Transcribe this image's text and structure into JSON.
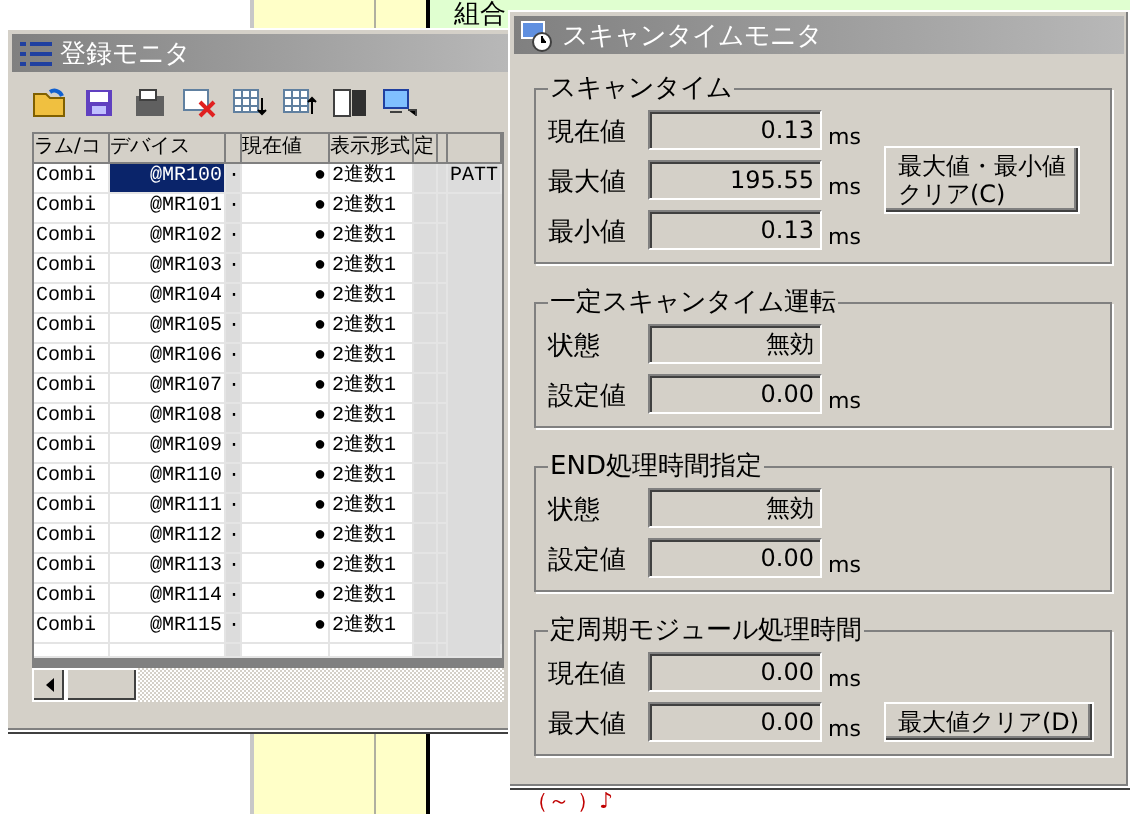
{
  "background": {
    "top_text": "組合",
    "bottom_text": "（～ ）♪"
  },
  "register_monitor": {
    "title": "登録モニタ",
    "columns": [
      "ラム/コ",
      "デバイス",
      "現在値",
      "表示形式",
      "定"
    ],
    "rows": [
      {
        "program": "Combi",
        "device": "@MR100",
        "flag": "·",
        "value": "●",
        "format": "2進数1",
        "comment": "PATT",
        "selected": true
      },
      {
        "program": "Combi",
        "device": "@MR101",
        "flag": "·",
        "value": "●",
        "format": "2進数1",
        "selected": false
      },
      {
        "program": "Combi",
        "device": "@MR102",
        "flag": "·",
        "value": "●",
        "format": "2進数1",
        "selected": false
      },
      {
        "program": "Combi",
        "device": "@MR103",
        "flag": "·",
        "value": "●",
        "format": "2進数1",
        "selected": false
      },
      {
        "program": "Combi",
        "device": "@MR104",
        "flag": "·",
        "value": "●",
        "format": "2進数1",
        "selected": false
      },
      {
        "program": "Combi",
        "device": "@MR105",
        "flag": "·",
        "value": "●",
        "format": "2進数1",
        "selected": false
      },
      {
        "program": "Combi",
        "device": "@MR106",
        "flag": "·",
        "value": "●",
        "format": "2進数1",
        "selected": false
      },
      {
        "program": "Combi",
        "device": "@MR107",
        "flag": "·",
        "value": "●",
        "format": "2進数1",
        "selected": false
      },
      {
        "program": "Combi",
        "device": "@MR108",
        "flag": "·",
        "value": "●",
        "format": "2進数1",
        "selected": false
      },
      {
        "program": "Combi",
        "device": "@MR109",
        "flag": "·",
        "value": "●",
        "format": "2進数1",
        "selected": false
      },
      {
        "program": "Combi",
        "device": "@MR110",
        "flag": "·",
        "value": "●",
        "format": "2進数1",
        "selected": false
      },
      {
        "program": "Combi",
        "device": "@MR111",
        "flag": "·",
        "value": "●",
        "format": "2進数1",
        "selected": false
      },
      {
        "program": "Combi",
        "device": "@MR112",
        "flag": "·",
        "value": "●",
        "format": "2進数1",
        "selected": false
      },
      {
        "program": "Combi",
        "device": "@MR113",
        "flag": "·",
        "value": "●",
        "format": "2進数1",
        "selected": false
      },
      {
        "program": "Combi",
        "device": "@MR114",
        "flag": "·",
        "value": "●",
        "format": "2進数1",
        "selected": false
      },
      {
        "program": "Combi",
        "device": "@MR115",
        "flag": "·",
        "value": "●",
        "format": "2進数1",
        "selected": false
      }
    ]
  },
  "scan_time_monitor": {
    "title": "スキャンタイムモニタ",
    "groups": [
      {
        "title": "スキャンタイム",
        "fields": [
          {
            "label": "現在値",
            "value": "0.13",
            "unit": "ms"
          },
          {
            "label": "最大値",
            "value": "195.55",
            "unit": "ms"
          },
          {
            "label": "最小値",
            "value": "0.13",
            "unit": "ms"
          }
        ],
        "button": [
          "最大値・最小値",
          "クリア(C)"
        ]
      },
      {
        "title": "一定スキャンタイム運転",
        "fields": [
          {
            "label": "状態",
            "value": "無効"
          },
          {
            "label": "設定値",
            "value": "0.00",
            "unit": "ms"
          }
        ]
      },
      {
        "title": "END処理時間指定",
        "fields": [
          {
            "label": "状態",
            "value": "無効"
          },
          {
            "label": "設定値",
            "value": "0.00",
            "unit": "ms"
          }
        ]
      },
      {
        "title": "定周期モジュール処理時間",
        "fields": [
          {
            "label": "現在値",
            "value": "0.00",
            "unit": "ms"
          },
          {
            "label": "最大値",
            "value": "0.00",
            "unit": "ms"
          }
        ],
        "button": [
          "最大値クリア(D)"
        ]
      }
    ]
  }
}
